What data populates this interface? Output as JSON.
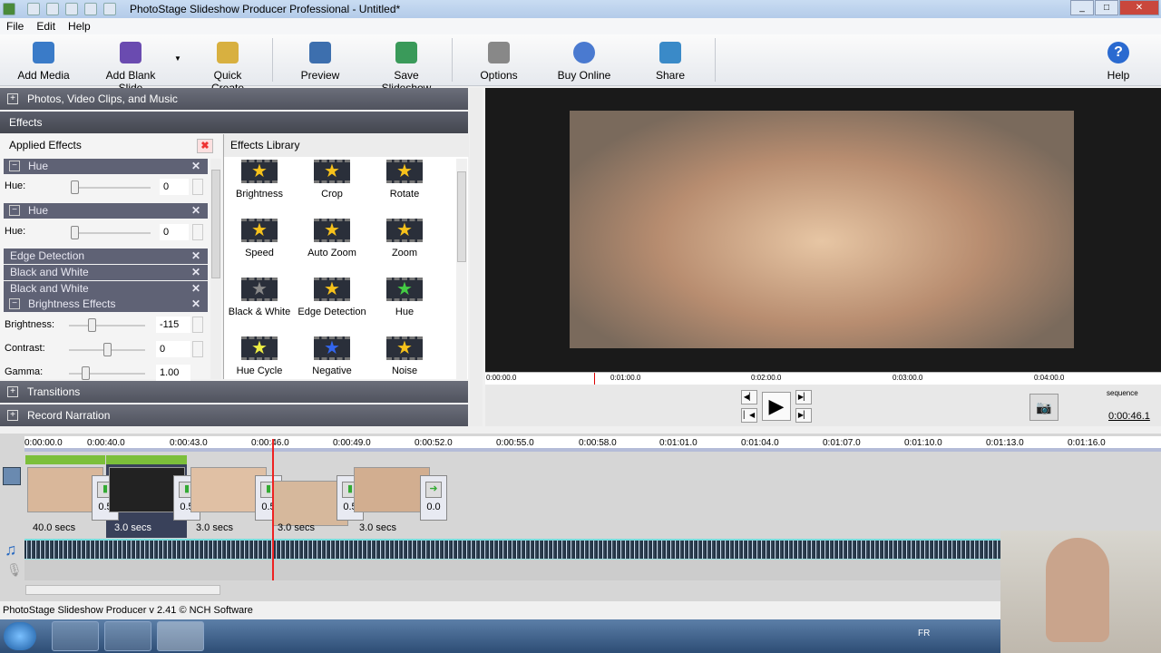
{
  "window": {
    "title": "PhotoStage Slideshow Producer Professional - Untitled*"
  },
  "menu": [
    "File",
    "Edit",
    "Help"
  ],
  "toolbar": {
    "add_media": "Add Media",
    "add_blank_slide": "Add Blank Slide",
    "quick_create": "Quick Create",
    "preview": "Preview",
    "save_slideshow": "Save Slideshow",
    "options": "Options",
    "buy_online": "Buy Online",
    "share": "Share",
    "help": "Help"
  },
  "panels": {
    "photos": "Photos, Video Clips, and Music",
    "effects": "Effects",
    "transitions": "Transitions",
    "narration": "Record Narration"
  },
  "applied": {
    "title": "Applied Effects",
    "hue1": {
      "name": "Hue",
      "label": "Hue:",
      "value": "0"
    },
    "hue2": {
      "name": "Hue",
      "label": "Hue:",
      "value": "0"
    },
    "edge": "Edge Detection",
    "bw1": "Black and White",
    "bw2": "Black and White",
    "bright": {
      "name": "Brightness Effects",
      "brightness_label": "Brightness:",
      "brightness": "-115",
      "contrast_label": "Contrast:",
      "contrast": "0",
      "gamma_label": "Gamma:",
      "gamma": "1.00"
    }
  },
  "library": {
    "title": "Effects Library",
    "items": [
      "Brightness",
      "Crop",
      "Rotate",
      "Speed",
      "Auto Zoom",
      "Zoom",
      "Black & White",
      "Edge Detection",
      "Hue",
      "Hue Cycle",
      "Negative",
      "Noise"
    ]
  },
  "preview": {
    "ruler": [
      "0:00:00.0",
      "0:01:00.0",
      "0:02:00.0",
      "0:03:00.0",
      "0:04:00.0"
    ],
    "sequence": "sequence",
    "time": "0:00:46.1"
  },
  "timeline": {
    "ruler": [
      "0:00:00.0",
      "0:00:40.0",
      "0:00:43.0",
      "0:00:46.0",
      "0:00:49.0",
      "0:00:52.0",
      "0:00:55.0",
      "0:00:58.0",
      "0:01:01.0",
      "0:01:04.0",
      "0:01:07.0",
      "0:01:10.0",
      "0:01:13.0",
      "0:01:16.0"
    ],
    "durations": [
      "40.0 secs",
      "3.0 secs",
      "3.0 secs",
      "3.0 secs",
      "3.0 secs"
    ],
    "transitions": [
      "0.5",
      "0.5",
      "0.5",
      "0.5",
      "0.0"
    ]
  },
  "status": "PhotoStage Slideshow Producer v 2.41 © NCH Software",
  "tray": {
    "lang": "FR"
  }
}
